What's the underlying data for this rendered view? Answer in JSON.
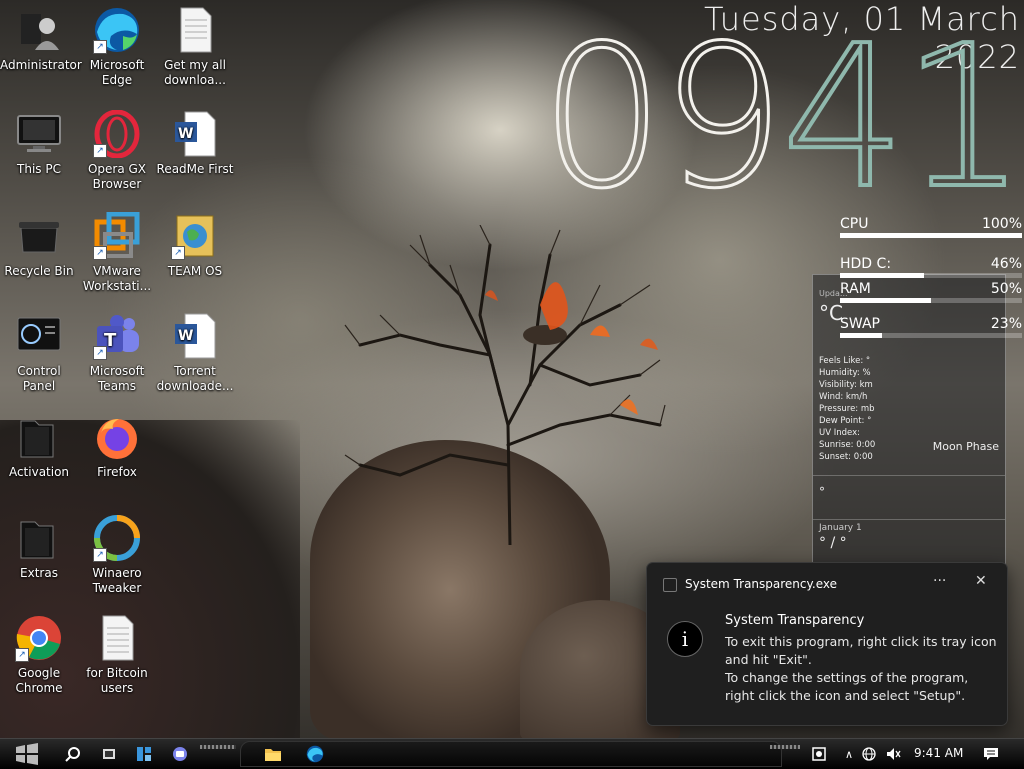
{
  "desktop": {
    "icons": [
      {
        "label": "Administrator",
        "icon": "user-folder-icon"
      },
      {
        "label": "Microsoft Edge",
        "icon": "edge-icon"
      },
      {
        "label": "Get my all downloa...",
        "icon": "text-file-icon"
      },
      {
        "label": "This PC",
        "icon": "monitor-icon"
      },
      {
        "label": "Opera GX Browser",
        "icon": "opera-icon"
      },
      {
        "label": "ReadMe First",
        "icon": "word-doc-icon"
      },
      {
        "label": "Recycle Bin",
        "icon": "recycle-bin-icon"
      },
      {
        "label": "VMware Workstati...",
        "icon": "vmware-icon"
      },
      {
        "label": "TEAM OS",
        "icon": "globe-book-icon"
      },
      {
        "label": "Control Panel",
        "icon": "control-panel-icon"
      },
      {
        "label": "Microsoft Teams",
        "icon": "teams-icon"
      },
      {
        "label": "Torrent downloade...",
        "icon": "word-doc-icon"
      },
      {
        "label": "Activation",
        "icon": "folder-icon"
      },
      {
        "label": "Firefox",
        "icon": "firefox-icon"
      },
      {
        "label": "Extras",
        "icon": "folder-icon"
      },
      {
        "label": "Winaero Tweaker",
        "icon": "winaero-icon"
      },
      {
        "label": "Google Chrome",
        "icon": "chrome-icon"
      },
      {
        "label": "for Bitcoin users",
        "icon": "text-file-icon"
      }
    ]
  },
  "clock": {
    "date": "Tuesday, 01  March  2022",
    "hours": "09",
    "minutes": "41"
  },
  "meters": [
    {
      "label": "CPU",
      "value": "100%",
      "fraction": 1.0
    },
    {
      "label": "HDD C:",
      "value": "46%",
      "fraction": 0.46
    },
    {
      "label": "RAM",
      "value": "50%",
      "fraction": 0.5
    },
    {
      "label": "SWAP",
      "value": "23%",
      "fraction": 0.23
    }
  ],
  "weather": {
    "updated": "Upda...",
    "temp_unit": "°C",
    "details": [
      "Feels Like: °",
      "Humidity: %",
      "Visibility:  km",
      "Wind:  km/h",
      "Pressure:  mb",
      "Dew Point: °",
      "UV Index:",
      "Sunrise: 0:00",
      "Sunset: 0:00"
    ],
    "moon_phase": "Moon Phase",
    "degree": "°",
    "forecast_date": "January 1",
    "hi_lo": "° / °"
  },
  "toast": {
    "app_name": "System Transparency.exe",
    "title": "System Transparency",
    "line1": "To exit this program, right click its tray icon and hit \"Exit\".",
    "line2": "To change the settings of the program, right click the icon and select \"Setup\".",
    "more": "···",
    "close": "✕",
    "info": "i"
  },
  "taskbar": {
    "time": "9:41 AM",
    "pinned": [
      "start-icon",
      "search-icon",
      "task-view-icon",
      "widgets-icon",
      "chat-icon",
      "file-explorer-icon",
      "edge-icon"
    ],
    "tray": [
      "network-icon",
      "language-icon",
      "volume-muted-icon",
      "notification-icon"
    ]
  }
}
